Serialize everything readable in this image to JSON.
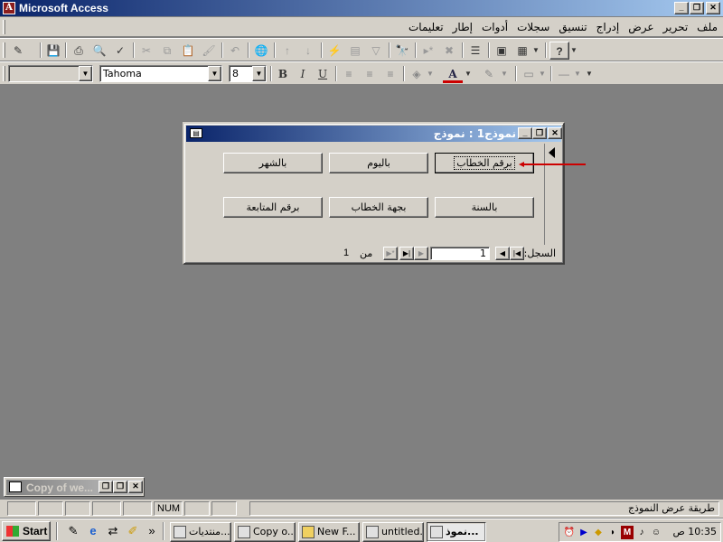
{
  "app": {
    "title": "Microsoft Access",
    "title_icon_glyph": "A",
    "minimize_glyph": "_",
    "maximize_glyph": "❐",
    "close_glyph": "✕"
  },
  "menu": {
    "items": [
      "ملف",
      "تحرير",
      "عرض",
      "إدراج",
      "تنسيق",
      "سجلات",
      "أدوات",
      "إطار",
      "تعليمات"
    ]
  },
  "toolbar1": {
    "buttons": [
      {
        "icon": "design-view-icon",
        "glyph": "✎"
      },
      {
        "icon": "save-icon",
        "glyph": "💾"
      },
      {
        "icon": "print-icon",
        "glyph": "⎙"
      },
      {
        "icon": "print-preview-icon",
        "glyph": "🔍"
      },
      {
        "icon": "spelling-icon",
        "glyph": "✓"
      },
      {
        "icon": "cut-icon",
        "glyph": "✂"
      },
      {
        "icon": "copy-icon",
        "glyph": "⧉"
      },
      {
        "icon": "paste-icon",
        "glyph": "📋"
      },
      {
        "icon": "format-painter-icon",
        "glyph": "🖌"
      },
      {
        "icon": "undo-icon",
        "glyph": "↶"
      },
      {
        "icon": "hyperlink-icon",
        "glyph": "🌐"
      },
      {
        "icon": "sort-ascending-icon",
        "glyph": "↑"
      },
      {
        "icon": "sort-descending-icon",
        "glyph": "↓"
      },
      {
        "icon": "filter-by-selection-icon",
        "glyph": "⚡"
      },
      {
        "icon": "filter-by-form-icon",
        "glyph": "▤"
      },
      {
        "icon": "apply-filter-icon",
        "glyph": "▽"
      },
      {
        "icon": "find-icon",
        "glyph": "🔭"
      },
      {
        "icon": "new-record-icon",
        "glyph": "▸*"
      },
      {
        "icon": "delete-record-icon",
        "glyph": "✖"
      },
      {
        "icon": "properties-icon",
        "glyph": "☰"
      },
      {
        "icon": "database-window-icon",
        "glyph": "▣"
      },
      {
        "icon": "new-object-icon",
        "glyph": "▦"
      },
      {
        "icon": "help-icon",
        "glyph": "?"
      }
    ]
  },
  "toolbar2": {
    "object_combo": "",
    "font_name": "Tahoma",
    "font_size": "8",
    "bold": "B",
    "italic": "I",
    "underline": "U",
    "align_left_glyph": "≡",
    "align_center_glyph": "≡",
    "align_right_glyph": "≡",
    "fill_color_glyph": "◈",
    "font_color_glyph": "A",
    "line_color_glyph": "✎",
    "border_glyph": "▭",
    "line_width_glyph": "—",
    "dropdown_glyph": "▼",
    "font_color": "#cc0000"
  },
  "form": {
    "title": "نموذج1 : نموذج",
    "icon_glyph": "▤",
    "buttons": [
      {
        "label": "برقم الخطاب",
        "focused": true
      },
      {
        "label": "باليوم",
        "focused": false
      },
      {
        "label": "بالشهر",
        "focused": false
      },
      {
        "label": "بالسنة",
        "focused": false
      },
      {
        "label": "بجهة الخطاب",
        "focused": false
      },
      {
        "label": "برقم المتابعة",
        "focused": false
      }
    ],
    "nav": {
      "record_label": "السجل:",
      "current_record": "1",
      "of_label": "من",
      "total_records": "1",
      "first_glyph": "|◀",
      "prev_glyph": "◀",
      "next_glyph": "▶",
      "last_glyph": "▶|",
      "new_glyph": "▶*"
    },
    "annotation_color": "#cc0000"
  },
  "minimized_window": {
    "title": "Copy of we..."
  },
  "statusbar": {
    "text": "طريقة عرض النموذج",
    "num": "NUM"
  },
  "taskbar": {
    "start": "Start",
    "quicklaunch_glyphs": [
      "✎",
      "e",
      "⇄",
      "✐"
    ],
    "overflow": "»",
    "tasks": [
      {
        "label": "منتديات...",
        "active": false
      },
      {
        "label": "Copy o...",
        "active": false
      },
      {
        "label": "New F...",
        "active": false
      },
      {
        "label": "untitled...",
        "active": false
      },
      {
        "label": "نموذ...",
        "active": true
      }
    ],
    "tray_glyphs": [
      "⏰",
      "▶",
      "◆",
      "◗",
      "M",
      "♪",
      "☺"
    ],
    "clock": "10:35 ص"
  }
}
